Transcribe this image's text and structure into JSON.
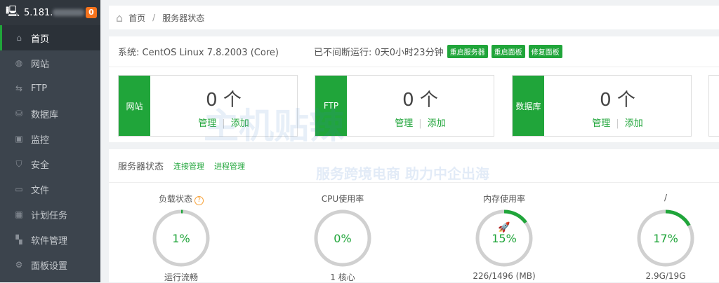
{
  "sidebar": {
    "host": "5.181.",
    "badge": "0",
    "items": [
      {
        "label": "首页",
        "icon": "home-icon",
        "glyph": "⌂"
      },
      {
        "label": "网站",
        "icon": "globe-icon",
        "glyph": "◍"
      },
      {
        "label": "FTP",
        "icon": "ftp-icon",
        "glyph": "⇆"
      },
      {
        "label": "数据库",
        "icon": "database-icon",
        "glyph": "⛁"
      },
      {
        "label": "监控",
        "icon": "monitor-icon",
        "glyph": "▣"
      },
      {
        "label": "安全",
        "icon": "shield-icon",
        "glyph": "⛉"
      },
      {
        "label": "文件",
        "icon": "folder-icon",
        "glyph": "▭"
      },
      {
        "label": "计划任务",
        "icon": "calendar-icon",
        "glyph": "▦"
      },
      {
        "label": "软件管理",
        "icon": "apps-icon",
        "glyph": "▚"
      },
      {
        "label": "面板设置",
        "icon": "gear-icon",
        "glyph": "⚙"
      }
    ]
  },
  "breadcrumb": {
    "home": "首页",
    "sep": "/",
    "current": "服务器状态"
  },
  "system": {
    "os": "系统: CentOS Linux 7.8.2003 (Core)",
    "uptime": "已不间断运行: 0天0小时23分钟",
    "buttons": [
      "重启服务器",
      "重启面板",
      "修复面板"
    ]
  },
  "cards": [
    {
      "label": "网站",
      "count": "0 个",
      "manage": "管理",
      "add": "添加"
    },
    {
      "label": "FTP",
      "count": "0 个",
      "manage": "管理",
      "add": "添加"
    },
    {
      "label": "数据库",
      "count": "0 个",
      "manage": "管理",
      "add": "添加"
    }
  ],
  "status": {
    "title": "服务器状态",
    "links": [
      "连接管理",
      "进程管理"
    ],
    "gauges": [
      {
        "title": "负载状态",
        "value": "1%",
        "percent": 1,
        "sub": "运行流畅",
        "help": "?"
      },
      {
        "title": "CPU使用率",
        "value": "0%",
        "percent": 0,
        "sub": "1 核心"
      },
      {
        "title": "内存使用率",
        "value": "15%",
        "percent": 15,
        "sub": "226/1496 (MB)"
      },
      {
        "title": "/",
        "value": "17%",
        "percent": 17,
        "sub": "2.9G/19G"
      }
    ]
  },
  "watermark": {
    "line1": "主机贴辣",
    "line2": "服务跨境电商 助力中企出海"
  },
  "colors": {
    "accent": "#20a53a",
    "sidebar": "#3c444d",
    "badge": "#f7731c"
  }
}
